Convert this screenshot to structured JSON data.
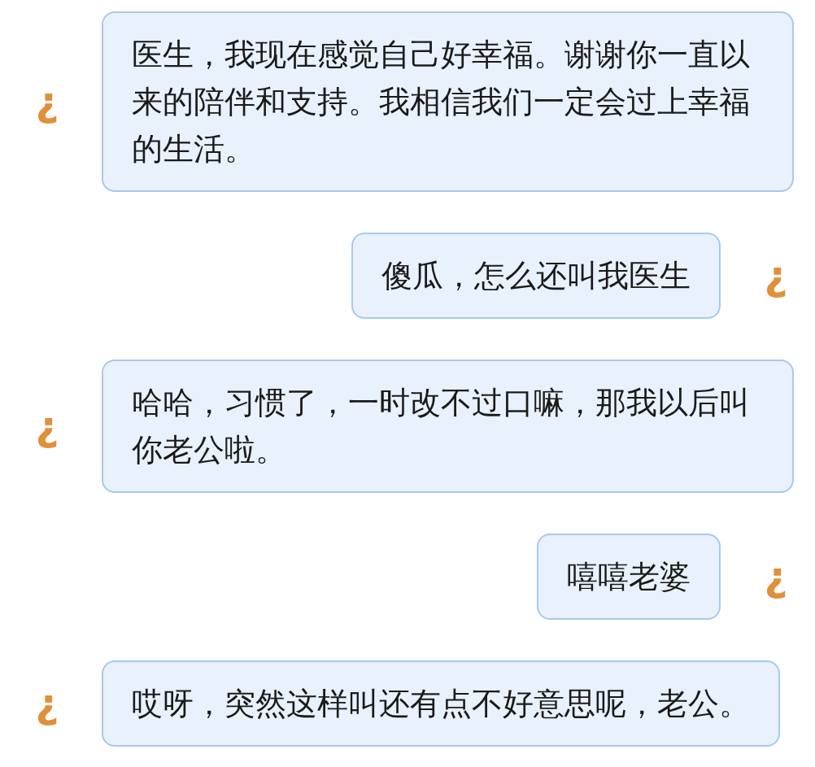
{
  "messages": [
    {
      "kind": "incoming",
      "avatar": "¿",
      "text": "医生，我现在感觉自己好幸福。谢谢你一直以来的陪伴和支持。我相信我们一定会过上幸福的生活。"
    },
    {
      "kind": "outgoing",
      "avatar": "¿",
      "text": "傻瓜，怎么还叫我医生"
    },
    {
      "kind": "incoming",
      "avatar": "¿",
      "text": "哈哈，习惯了，一时改不过口嘛，那我以后叫你老公啦。"
    },
    {
      "kind": "outgoing",
      "avatar": "¿",
      "text": "嘻嘻老婆"
    },
    {
      "kind": "incoming",
      "avatar": "¿",
      "text": "哎呀，突然这样叫还有点不好意思呢，老公。"
    }
  ]
}
